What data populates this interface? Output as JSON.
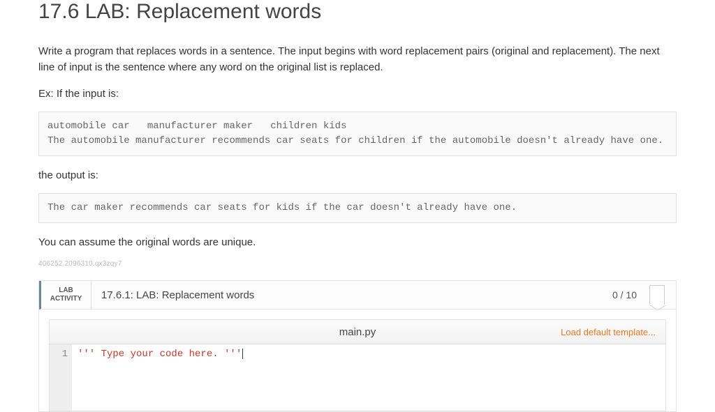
{
  "title": "17.6 LAB: Replacement words",
  "intro": "Write a program that replaces words in a sentence. The input begins with word replacement pairs (original and replacement). The next line of input is the sentence where any word on the original list is replaced.",
  "ex_input_label": "Ex: If the input is:",
  "example_input": "automobile car   manufacturer maker   children kids\nThe automobile manufacturer recommends car seats for children if the automobile doesn't already have one.",
  "output_label": "the output is:",
  "example_output": "The car maker recommends car seats for kids if the car doesn't already have one.",
  "assumption": "You can assume the original words are unique.",
  "hash": "406252.2096310.qx3zqy7",
  "lab": {
    "badge_line1": "LAB",
    "badge_line2": "ACTIVITY",
    "title": "17.6.1: LAB: Replacement words",
    "score": "0 / 10",
    "file_name": "main.py",
    "load_template": "Load default template...",
    "editor": {
      "line_number": "1",
      "line1": "''' Type your code here. '''"
    }
  }
}
